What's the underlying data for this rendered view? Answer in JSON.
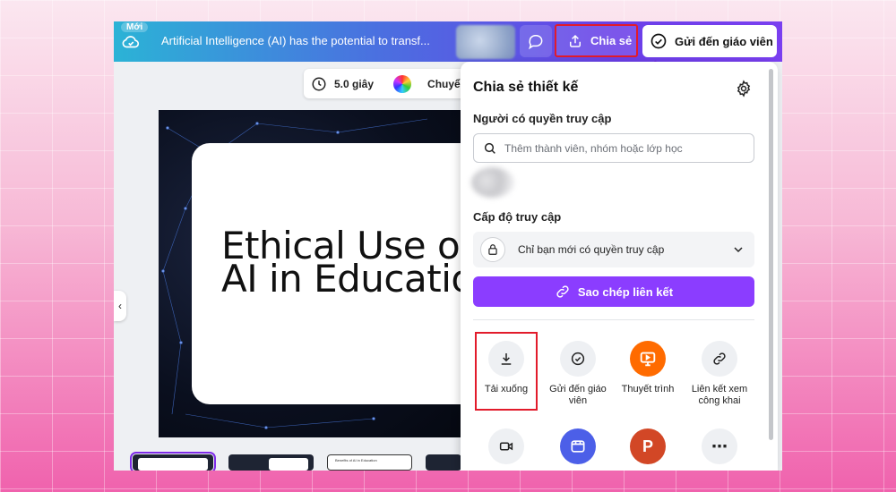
{
  "topbar": {
    "new_badge": "Mới",
    "doc_title": "Artificial Intelligence (AI) has the potential to transf...",
    "share_label": "Chia sẻ",
    "send_label": "Gửi đến giáo viên"
  },
  "canvas_toolbar": {
    "duration": "5.0 giây",
    "transition_label": "Chuyể"
  },
  "slide": {
    "heading": "Ethical Use of\nAI in Educatio"
  },
  "thumbnails": {
    "thumb3_text": "Benefits of AI in Education"
  },
  "share_panel": {
    "title": "Chia sẻ thiết kế",
    "access_people_label": "Người có quyền truy cập",
    "search_placeholder": "Thêm thành viên, nhóm hoặc lớp học",
    "access_level_label": "Cấp độ truy cập",
    "access_level_value": "Chỉ bạn mới có quyền truy cập",
    "copy_link_label": "Sao chép liên kết",
    "options": [
      {
        "label": "Tải xuống",
        "icon": "download-icon"
      },
      {
        "label": "Gửi đến giáo viên",
        "icon": "check-circle-icon"
      },
      {
        "label": "Thuyết trình",
        "icon": "present-icon"
      },
      {
        "label": "Liên kết xem công khai",
        "icon": "link-icon"
      },
      {
        "label": "",
        "icon": "video-icon"
      },
      {
        "label": "",
        "icon": "app-icon"
      },
      {
        "label": "",
        "icon": "powerpoint-icon"
      },
      {
        "label": "",
        "icon": "more-icon"
      }
    ]
  },
  "colors": {
    "accent_purple": "#8b3dff",
    "highlight_red": "#e21b2b",
    "present_orange": "#ff6b00",
    "app_blue": "#4c5fe8",
    "powerpoint_red": "#d24726"
  }
}
